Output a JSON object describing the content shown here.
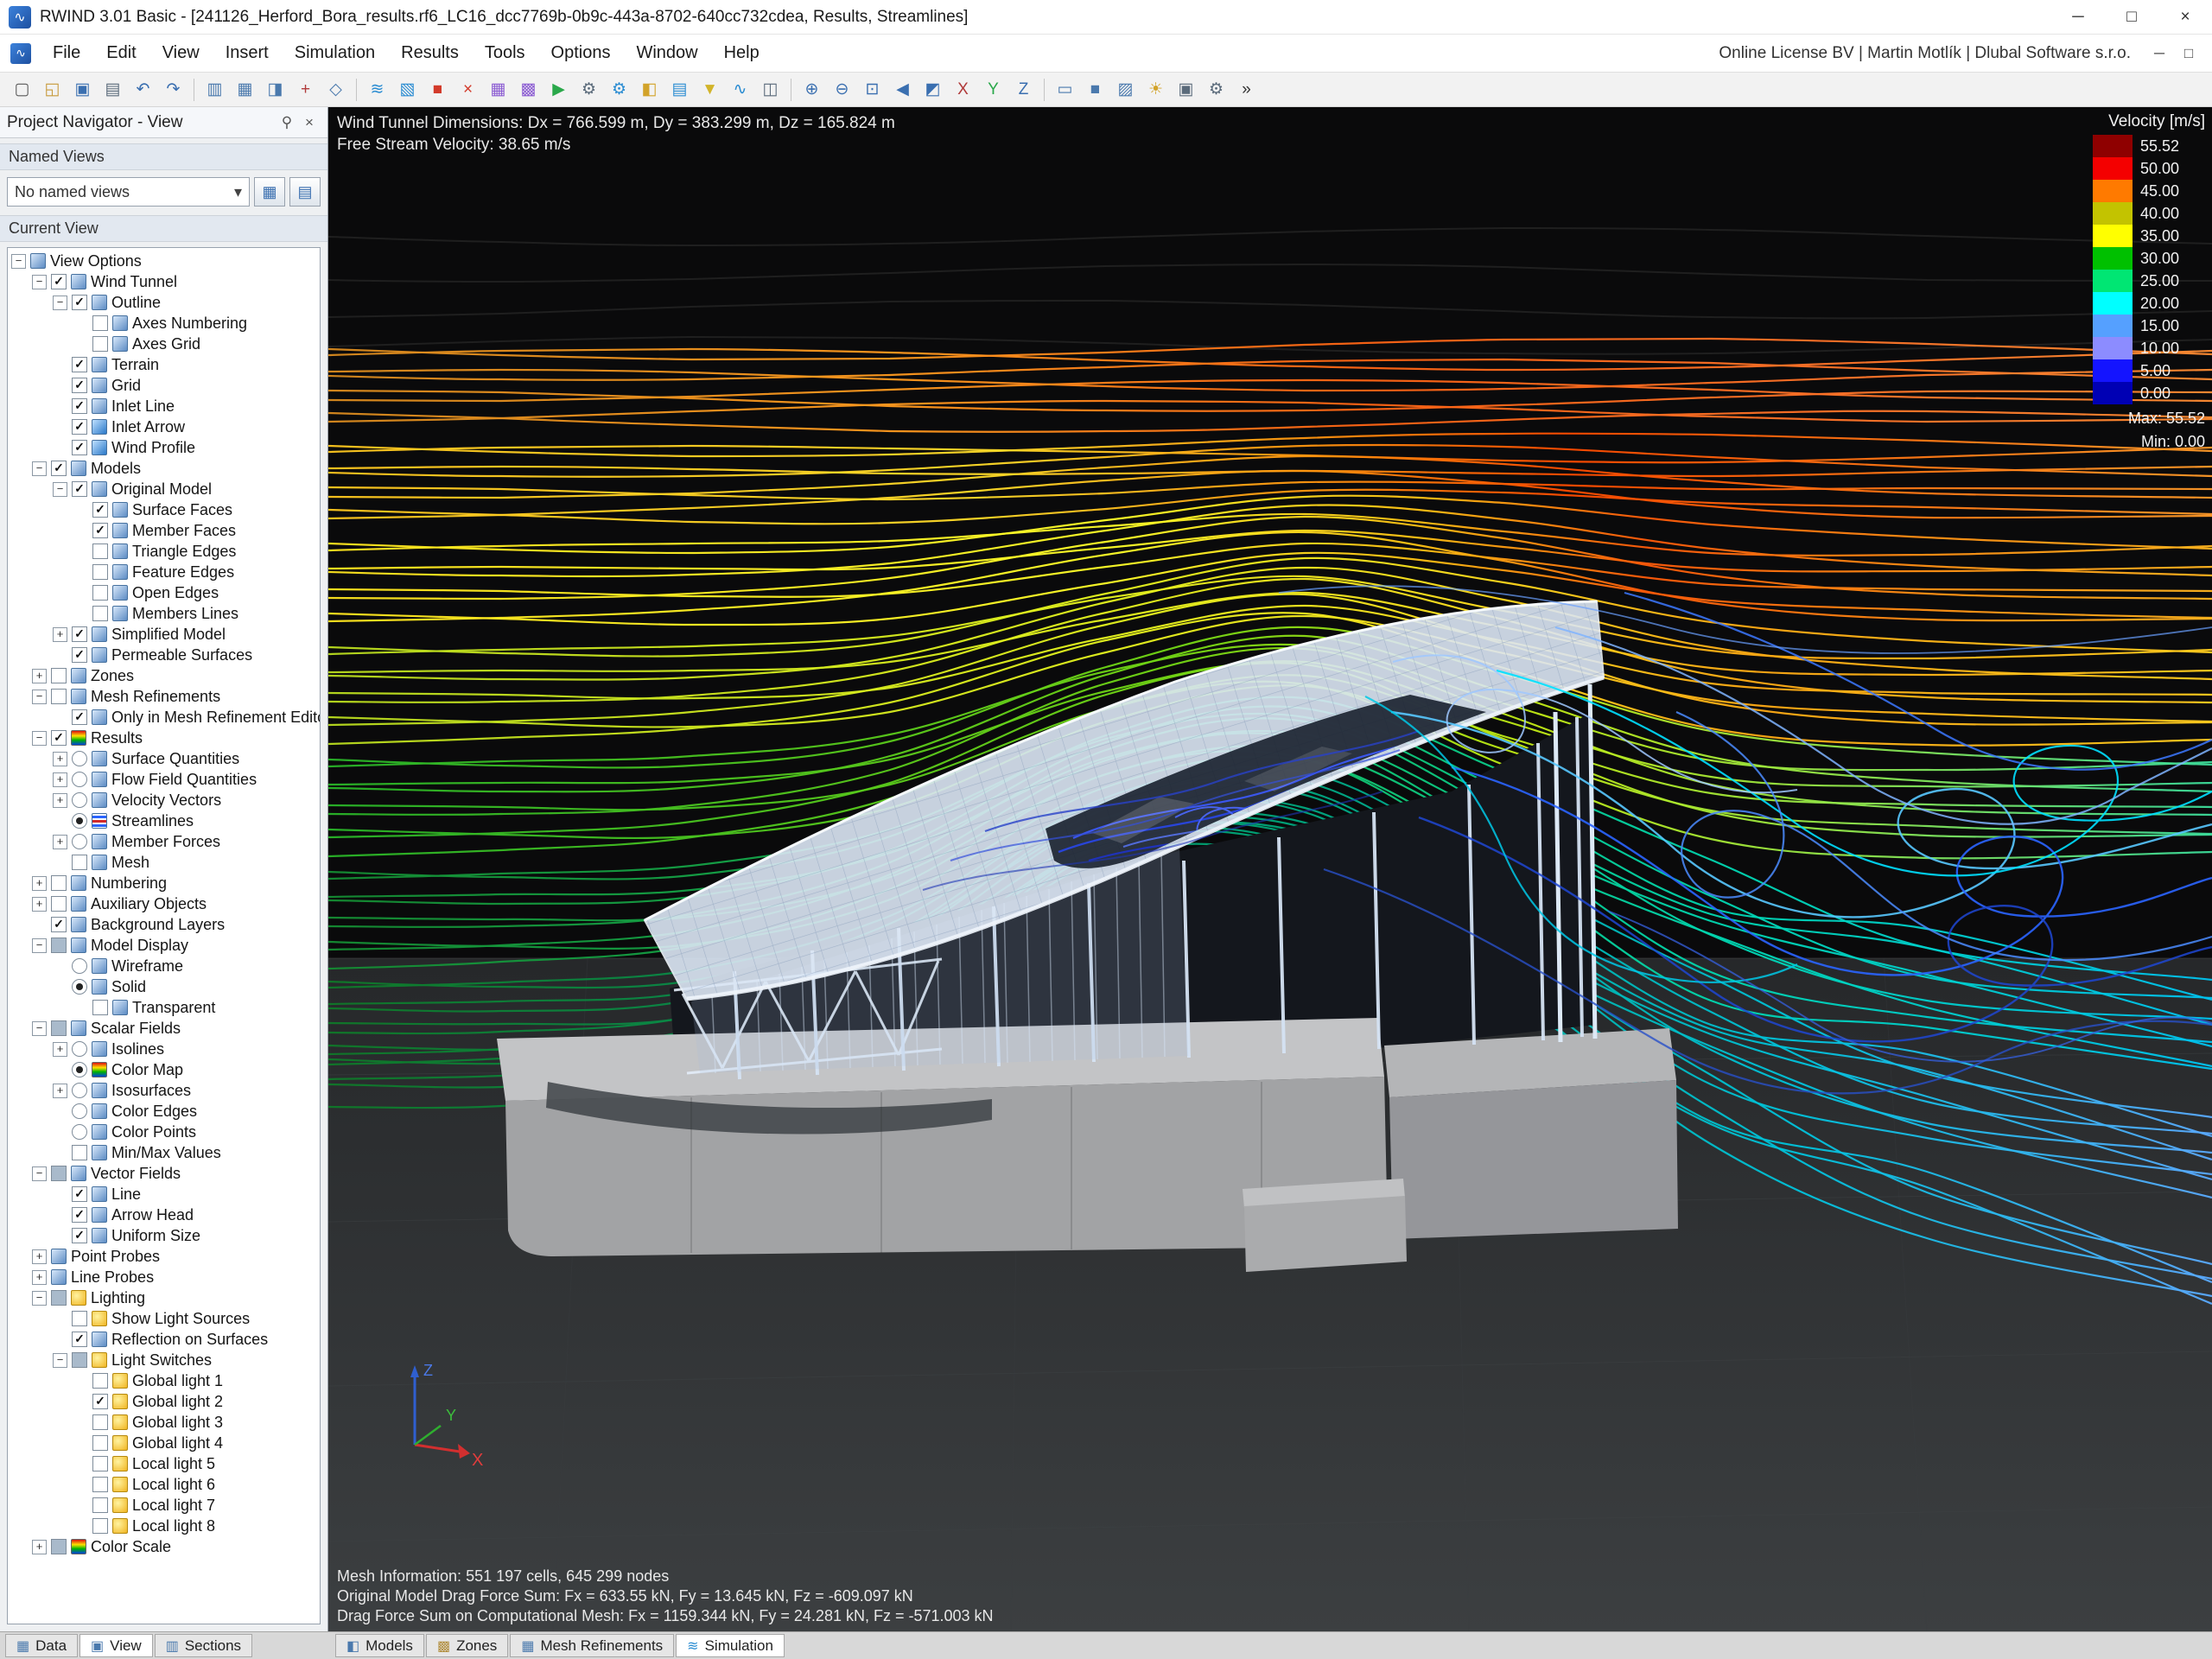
{
  "window": {
    "title": "RWIND 3.01 Basic - [241126_Herford_Bora_results.rf6_LC16_dcc7769b-0b9c-443a-8702-640cc732cdea, Results, Streamlines]",
    "app_icon_glyph": "∿",
    "controls": [
      "─",
      "□",
      "×"
    ],
    "mdi_controls": [
      "─",
      "□"
    ]
  },
  "menu": {
    "items": [
      "File",
      "Edit",
      "View",
      "Insert",
      "Simulation",
      "Results",
      "Tools",
      "Options",
      "Window",
      "Help"
    ],
    "license": "Online License BV | Martin Motlík | Dlubal Software s.r.o."
  },
  "toolbar": {
    "groups": [
      [
        {
          "name": "new-model",
          "glyph": "▢",
          "color": "#5a5a5a"
        },
        {
          "name": "open-model",
          "glyph": "◱",
          "color": "#c79a3c"
        },
        {
          "name": "save",
          "glyph": "▣",
          "color": "#3a6fb0"
        },
        {
          "name": "print",
          "glyph": "▤",
          "color": "#5a6a7a"
        },
        {
          "name": "undo",
          "glyph": "↶",
          "color": "#3a6fb0"
        },
        {
          "name": "redo",
          "glyph": "↷",
          "color": "#3a6fb0"
        }
      ],
      [
        {
          "name": "navigator",
          "glyph": "▥",
          "color": "#4a79ad"
        },
        {
          "name": "tables",
          "glyph": "▦",
          "color": "#4a79ad"
        },
        {
          "name": "rendering",
          "glyph": "◨",
          "color": "#4a79ad"
        },
        {
          "name": "crosshair",
          "glyph": "+",
          "color": "#b03a3a"
        },
        {
          "name": "work-plane",
          "glyph": "◇",
          "color": "#4a79ad"
        }
      ],
      [
        {
          "name": "wind-tunnel",
          "glyph": "≋",
          "color": "#2a8cd2"
        },
        {
          "name": "edit-wind-tunnel",
          "glyph": "▧",
          "color": "#2a8cd2"
        },
        {
          "name": "stop-calculation",
          "glyph": "■",
          "color": "#d23a2a"
        },
        {
          "name": "cancel",
          "glyph": "×",
          "color": "#d23a2a"
        },
        {
          "name": "generate-mesh",
          "glyph": "▦",
          "color": "#8a5ad2"
        },
        {
          "name": "mesh-settings",
          "glyph": "▩",
          "color": "#8a5ad2"
        },
        {
          "name": "run-simulation",
          "glyph": "▶",
          "color": "#2aa84a"
        },
        {
          "name": "simulation-settings",
          "glyph": "⚙",
          "color": "#5a6a7a"
        },
        {
          "name": "calculation-parameters",
          "glyph": "⚙",
          "color": "#2a8cd2"
        },
        {
          "name": "show-results",
          "glyph": "◧",
          "color": "#d2a32a"
        },
        {
          "name": "result-tables",
          "glyph": "▤",
          "color": "#2a8cd2"
        },
        {
          "name": "filter-results",
          "glyph": "▼",
          "color": "#d2b42a"
        },
        {
          "name": "animate-flow",
          "glyph": "∿",
          "color": "#2a8cd2"
        },
        {
          "name": "clipping-plane",
          "glyph": "◫",
          "color": "#5a6a7a"
        }
      ],
      [
        {
          "name": "zoom-in",
          "glyph": "⊕",
          "color": "#3a6fb0"
        },
        {
          "name": "zoom-out",
          "glyph": "⊖",
          "color": "#3a6fb0"
        },
        {
          "name": "zoom-fit",
          "glyph": "⊡",
          "color": "#3a6fb0"
        },
        {
          "name": "previous-view",
          "glyph": "◀",
          "color": "#3a6fb0"
        },
        {
          "name": "isometric-view",
          "glyph": "◩",
          "color": "#3a6fb0"
        },
        {
          "name": "view-x",
          "glyph": "X",
          "color": "#b03a3a"
        },
        {
          "name": "view-y",
          "glyph": "Y",
          "color": "#2aa84a"
        },
        {
          "name": "view-z",
          "glyph": "Z",
          "color": "#3a6fb0"
        }
      ],
      [
        {
          "name": "wireframe-mode",
          "glyph": "▭",
          "color": "#4a79ad"
        },
        {
          "name": "solid-mode",
          "glyph": "■",
          "color": "#4a79ad"
        },
        {
          "name": "shaded-mode",
          "glyph": "▨",
          "color": "#4a79ad"
        },
        {
          "name": "lighting-toggle",
          "glyph": "☀",
          "color": "#d2a32a"
        },
        {
          "name": "screenshot",
          "glyph": "▣",
          "color": "#5a6a7a"
        },
        {
          "name": "settings",
          "glyph": "⚙",
          "color": "#5a6a7a"
        },
        {
          "name": "more",
          "glyph": "»",
          "color": "#333333"
        }
      ]
    ]
  },
  "navigator": {
    "title": "Project Navigator - View",
    "pin_glyph": "⚲",
    "close_glyph": "×",
    "sections": {
      "named_views": "Named Views",
      "current_view": "Current View"
    },
    "named_views_value": "No named views",
    "dropdown_arrow": "▾",
    "buttons": [
      {
        "name": "named-views-table-button",
        "glyph": "▦"
      },
      {
        "name": "named-views-save-button",
        "glyph": "▤"
      }
    ],
    "tree": [
      {
        "level": 0,
        "label": "View Options",
        "expand": "minus",
        "check": "none",
        "icon": "view-options"
      },
      {
        "level": 1,
        "label": "Wind Tunnel",
        "expand": "minus",
        "check": "checked",
        "icon": "wind-tunnel"
      },
      {
        "level": 2,
        "label": "Outline",
        "expand": "minus",
        "check": "checked",
        "icon": "outline"
      },
      {
        "level": 3,
        "label": "Axes Numbering",
        "expand": "none",
        "check": "unchecked",
        "icon": "axes-numbering"
      },
      {
        "level": 3,
        "label": "Axes Grid",
        "expand": "none",
        "check": "unchecked",
        "icon": "axes-grid"
      },
      {
        "level": 2,
        "label": "Terrain",
        "expand": "none",
        "check": "checked",
        "icon": "terrain"
      },
      {
        "level": 2,
        "label": "Grid",
        "expand": "none",
        "check": "checked",
        "icon": "grid"
      },
      {
        "level": 2,
        "label": "Inlet Line",
        "expand": "none",
        "check": "checked",
        "icon": "inlet-line"
      },
      {
        "level": 2,
        "label": "Inlet Arrow",
        "expand": "none",
        "check": "checked",
        "icon": "inlet-arrow"
      },
      {
        "level": 2,
        "label": "Wind Profile",
        "expand": "none",
        "check": "checked",
        "icon": "wind-profile"
      },
      {
        "level": 1,
        "label": "Models",
        "expand": "minus",
        "check": "checked",
        "icon": "models"
      },
      {
        "level": 2,
        "label": "Original Model",
        "expand": "minus",
        "check": "checked",
        "icon": "original-model"
      },
      {
        "level": 3,
        "label": "Surface Faces",
        "expand": "none",
        "check": "checked",
        "icon": "surface-faces"
      },
      {
        "level": 3,
        "label": "Member Faces",
        "expand": "none",
        "check": "checked",
        "icon": "member-faces"
      },
      {
        "level": 3,
        "label": "Triangle Edges",
        "expand": "none",
        "check": "unchecked",
        "icon": "triangle-edges"
      },
      {
        "level": 3,
        "label": "Feature Edges",
        "expand": "none",
        "check": "unchecked",
        "icon": "feature-edges"
      },
      {
        "level": 3,
        "label": "Open Edges",
        "expand": "none",
        "check": "unchecked",
        "icon": "open-edges"
      },
      {
        "level": 3,
        "label": "Members Lines",
        "expand": "none",
        "check": "unchecked",
        "icon": "members-lines"
      },
      {
        "level": 2,
        "label": "Simplified Model",
        "expand": "plus",
        "check": "checked",
        "icon": "simplified-model"
      },
      {
        "level": 2,
        "label": "Permeable Surfaces",
        "expand": "none",
        "check": "checked",
        "icon": "permeable-surfaces"
      },
      {
        "level": 1,
        "label": "Zones",
        "expand": "plus",
        "check": "unchecked",
        "icon": "zones"
      },
      {
        "level": 1,
        "label": "Mesh Refinements",
        "expand": "minus",
        "check": "unchecked",
        "icon": "mesh-refinements"
      },
      {
        "level": 2,
        "label": "Only in Mesh Refinement Editor",
        "expand": "none",
        "check": "checked",
        "icon": "mesh-refinement-editor"
      },
      {
        "level": 1,
        "label": "Results",
        "expand": "minus",
        "check": "checked",
        "icon": "results"
      },
      {
        "level": 2,
        "label": "Surface Quantities",
        "expand": "plus",
        "check": "radio-off",
        "icon": "surface-quantities"
      },
      {
        "level": 2,
        "label": "Flow Field Quantities",
        "expand": "plus",
        "check": "radio-off",
        "icon": "flow-field-quantities"
      },
      {
        "level": 2,
        "label": "Velocity Vectors",
        "expand": "plus",
        "check": "radio-off",
        "icon": "velocity-vectors"
      },
      {
        "level": 2,
        "label": "Streamlines",
        "expand": "none",
        "check": "radio-on",
        "icon": "streamlines"
      },
      {
        "level": 2,
        "label": "Member Forces",
        "expand": "plus",
        "check": "radio-off",
        "icon": "member-forces"
      },
      {
        "level": 2,
        "label": "Mesh",
        "expand": "none",
        "check": "unchecked",
        "icon": "mesh"
      },
      {
        "level": 1,
        "label": "Numbering",
        "expand": "plus",
        "check": "unchecked",
        "icon": "numbering"
      },
      {
        "level": 1,
        "label": "Auxiliary Objects",
        "expand": "plus",
        "check": "unchecked",
        "icon": "auxiliary-objects"
      },
      {
        "level": 1,
        "label": "Background Layers",
        "expand": "none",
        "check": "checked",
        "icon": "background-layers"
      },
      {
        "level": 1,
        "label": "Model Display",
        "expand": "minus",
        "check": "partial",
        "icon": "model-display"
      },
      {
        "level": 2,
        "label": "Wireframe",
        "expand": "none",
        "check": "radio-off",
        "icon": "wireframe"
      },
      {
        "level": 2,
        "label": "Solid",
        "expand": "none",
        "check": "radio-on",
        "icon": "solid"
      },
      {
        "level": 3,
        "label": "Transparent",
        "expand": "none",
        "check": "unchecked",
        "icon": "transparent"
      },
      {
        "level": 1,
        "label": "Scalar Fields",
        "expand": "minus",
        "check": "partial",
        "icon": "scalar-fields"
      },
      {
        "level": 2,
        "label": "Isolines",
        "expand": "plus",
        "check": "radio-off",
        "icon": "isolines"
      },
      {
        "level": 2,
        "label": "Color Map",
        "expand": "none",
        "check": "radio-on",
        "icon": "color-map"
      },
      {
        "level": 2,
        "label": "Isosurfaces",
        "expand": "plus",
        "check": "radio-off",
        "icon": "isosurfaces"
      },
      {
        "level": 2,
        "label": "Color Edges",
        "expand": "none",
        "check": "radio-off",
        "icon": "color-edges"
      },
      {
        "level": 2,
        "label": "Color Points",
        "expand": "none",
        "check": "radio-off",
        "icon": "color-points"
      },
      {
        "level": 2,
        "label": "Min/Max Values",
        "expand": "none",
        "check": "unchecked",
        "icon": "min-max-values"
      },
      {
        "level": 1,
        "label": "Vector Fields",
        "expand": "minus",
        "check": "partial",
        "icon": "vector-fields"
      },
      {
        "level": 2,
        "label": "Line",
        "expand": "none",
        "check": "checked",
        "icon": "line"
      },
      {
        "level": 2,
        "label": "Arrow Head",
        "expand": "none",
        "check": "checked",
        "icon": "arrow-head"
      },
      {
        "level": 2,
        "label": "Uniform Size",
        "expand": "none",
        "check": "checked",
        "icon": "uniform-size"
      },
      {
        "level": 1,
        "label": "Point Probes",
        "expand": "plus",
        "check": "none",
        "icon": "point-probes"
      },
      {
        "level": 1,
        "label": "Line Probes",
        "expand": "plus",
        "check": "none",
        "icon": "line-probes"
      },
      {
        "level": 1,
        "label": "Lighting",
        "expand": "minus",
        "check": "partial",
        "icon": "lighting"
      },
      {
        "level": 2,
        "label": "Show Light Sources",
        "expand": "none",
        "check": "unchecked",
        "icon": "show-light-sources"
      },
      {
        "level": 2,
        "label": "Reflection on Surfaces",
        "expand": "none",
        "check": "checked",
        "icon": "reflection-on-surfaces"
      },
      {
        "level": 2,
        "label": "Light Switches",
        "expand": "minus",
        "check": "partial",
        "icon": "light-switches"
      },
      {
        "level": 3,
        "label": "Global light 1",
        "expand": "none",
        "check": "unchecked",
        "icon": "global-light"
      },
      {
        "level": 3,
        "label": "Global light 2",
        "expand": "none",
        "check": "checked",
        "icon": "global-light"
      },
      {
        "level": 3,
        "label": "Global light 3",
        "expand": "none",
        "check": "unchecked",
        "icon": "global-light"
      },
      {
        "level": 3,
        "label": "Global light 4",
        "expand": "none",
        "check": "unchecked",
        "icon": "global-light"
      },
      {
        "level": 3,
        "label": "Local light 5",
        "expand": "none",
        "check": "unchecked",
        "icon": "local-light"
      },
      {
        "level": 3,
        "label": "Local light 6",
        "expand": "none",
        "check": "unchecked",
        "icon": "local-light"
      },
      {
        "level": 3,
        "label": "Local light 7",
        "expand": "none",
        "check": "unchecked",
        "icon": "local-light"
      },
      {
        "level": 3,
        "label": "Local light 8",
        "expand": "none",
        "check": "unchecked",
        "icon": "local-light"
      },
      {
        "level": 1,
        "label": "Color Scale",
        "expand": "plus",
        "check": "partial",
        "icon": "color-scale"
      }
    ]
  },
  "viewport": {
    "info_top": [
      "Wind Tunnel Dimensions: Dx = 766.599 m, Dy = 383.299 m, Dz = 165.824 m",
      "Free Stream Velocity: 38.65 m/s"
    ],
    "info_bottom": [
      "Mesh Information: 551 197 cells, 645 299 nodes",
      "Original Model Drag Force Sum: Fx = 633.55 kN, Fy = 13.645 kN, Fz = -609.097 kN",
      "Drag Force Sum on Computational Mesh: Fx = 1159.344 kN, Fy = 24.281 kN, Fz = -571.003 kN"
    ],
    "axis": {
      "x": "X",
      "y": "Y",
      "z": "Z"
    },
    "legend": {
      "title": "Velocity [m/s]",
      "entries": [
        {
          "label": "55.52",
          "color": "#8f0000"
        },
        {
          "label": "50.00",
          "color": "#f40000"
        },
        {
          "label": "45.00",
          "color": "#ff7a00"
        },
        {
          "label": "40.00",
          "color": "#c3c300"
        },
        {
          "label": "35.00",
          "color": "#ffff00"
        },
        {
          "label": "30.00",
          "color": "#00c000"
        },
        {
          "label": "25.00",
          "color": "#00e673"
        },
        {
          "label": "20.00",
          "color": "#00ffff"
        },
        {
          "label": "15.00",
          "color": "#55a0ff"
        },
        {
          "label": "10.00",
          "color": "#8c8cff"
        },
        {
          "label": "5.00",
          "color": "#1414ff"
        },
        {
          "label": "0.00",
          "color": "#0000b4"
        }
      ],
      "max_label": "Max:  55.52",
      "min_label": "Min:  0.00"
    }
  },
  "tabs": {
    "left": [
      {
        "label": "Data",
        "glyph": "▦",
        "color": "#4a79ad",
        "active": false
      },
      {
        "label": "View",
        "glyph": "▣",
        "color": "#4a79ad",
        "active": true
      },
      {
        "label": "Sections",
        "glyph": "▥",
        "color": "#4a79ad",
        "active": false
      }
    ],
    "main": [
      {
        "label": "Models",
        "glyph": "◧",
        "color": "#4a79ad",
        "active": false
      },
      {
        "label": "Zones",
        "glyph": "▩",
        "color": "#b08c3a",
        "active": false
      },
      {
        "label": "Mesh Refinements",
        "glyph": "▦",
        "color": "#4a79ad",
        "active": false
      },
      {
        "label": "Simulation",
        "glyph": "≋",
        "color": "#2a8cd2",
        "active": true
      }
    ]
  }
}
